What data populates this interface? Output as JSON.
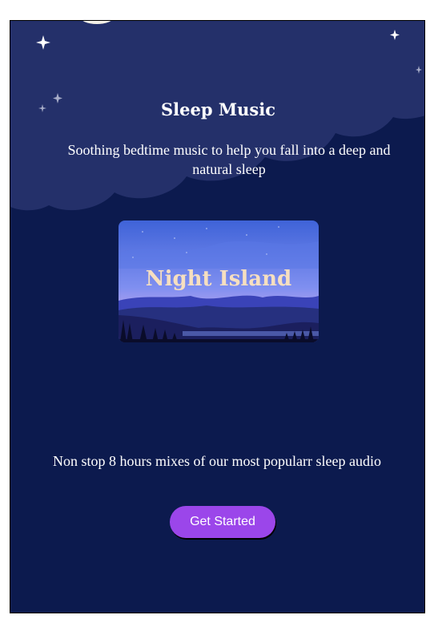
{
  "hero": {
    "title": "Sleep Music",
    "subtitle": "Soothing bedtime music to help you fall into a deep and natural sleep"
  },
  "featured_card": {
    "title": "Night Island"
  },
  "body": {
    "description": "Non stop 8 hours mixes of our most popularr sleep audio"
  },
  "cta": {
    "label": "Get Started"
  },
  "colors": {
    "background": "#0c1a4e",
    "cloud": "#24306a",
    "accent": "#9b46ea",
    "card_title": "#f6dfc0"
  },
  "icons": [
    "star-icon",
    "moon-icon",
    "crescent-moon-icon"
  ]
}
